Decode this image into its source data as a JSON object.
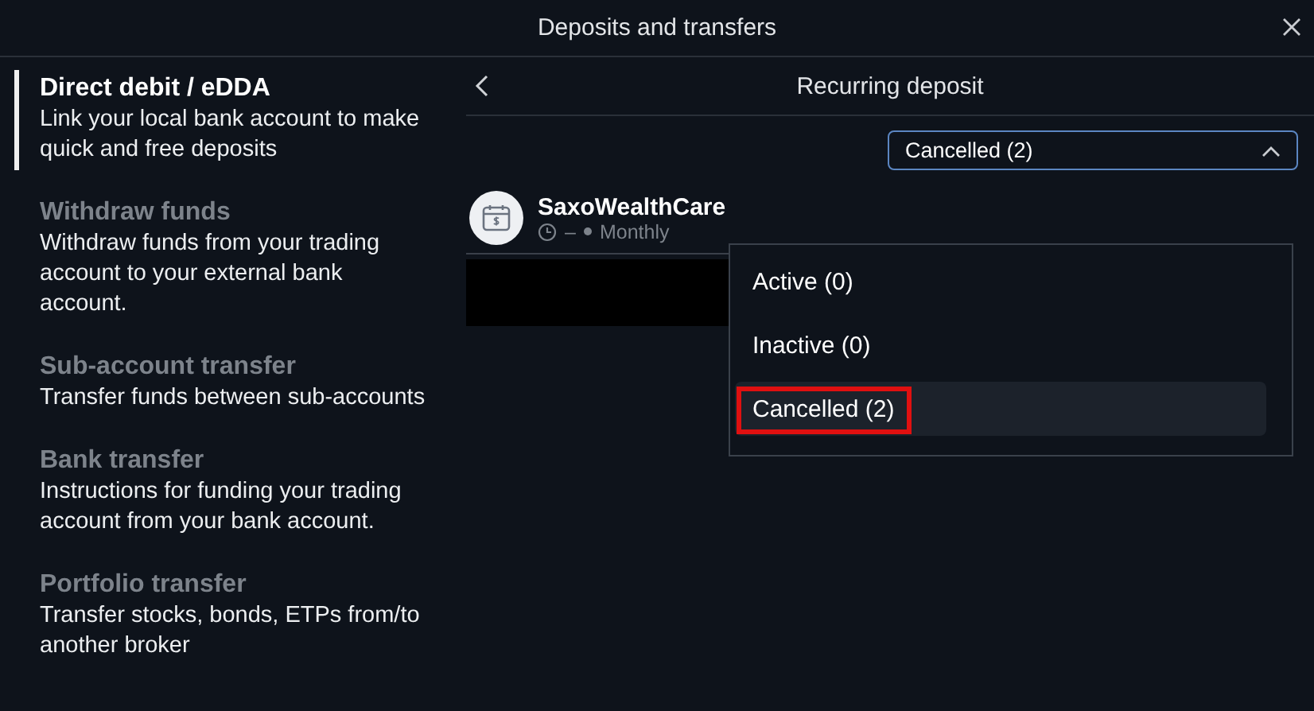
{
  "window": {
    "title": "Deposits and transfers"
  },
  "sidebar": {
    "items": [
      {
        "title": "Direct debit / eDDA",
        "description": "Link your local bank account to make quick and free deposits",
        "selected": true
      },
      {
        "title": "Withdraw funds",
        "description": "Withdraw funds from your trading account to your external bank account.",
        "selected": false
      },
      {
        "title": "Sub-account transfer",
        "description": "Transfer funds between sub-accounts",
        "selected": false
      },
      {
        "title": "Bank transfer",
        "description": "Instructions for funding your trading account from your bank account.",
        "selected": false
      },
      {
        "title": "Portfolio transfer",
        "description": "Transfer stocks, bonds, ETPs from/to another broker",
        "selected": false
      }
    ]
  },
  "panel": {
    "title": "Recurring deposit",
    "filter": {
      "value": "Cancelled (2)",
      "expanded": true,
      "options": [
        {
          "label": "Active (0)",
          "selected": false
        },
        {
          "label": "Inactive (0)",
          "selected": false
        },
        {
          "label": "Cancelled (2)",
          "selected": true
        }
      ]
    },
    "plan": {
      "name": "SaxoWealthCare",
      "date": "–",
      "frequency": "Monthly"
    }
  }
}
